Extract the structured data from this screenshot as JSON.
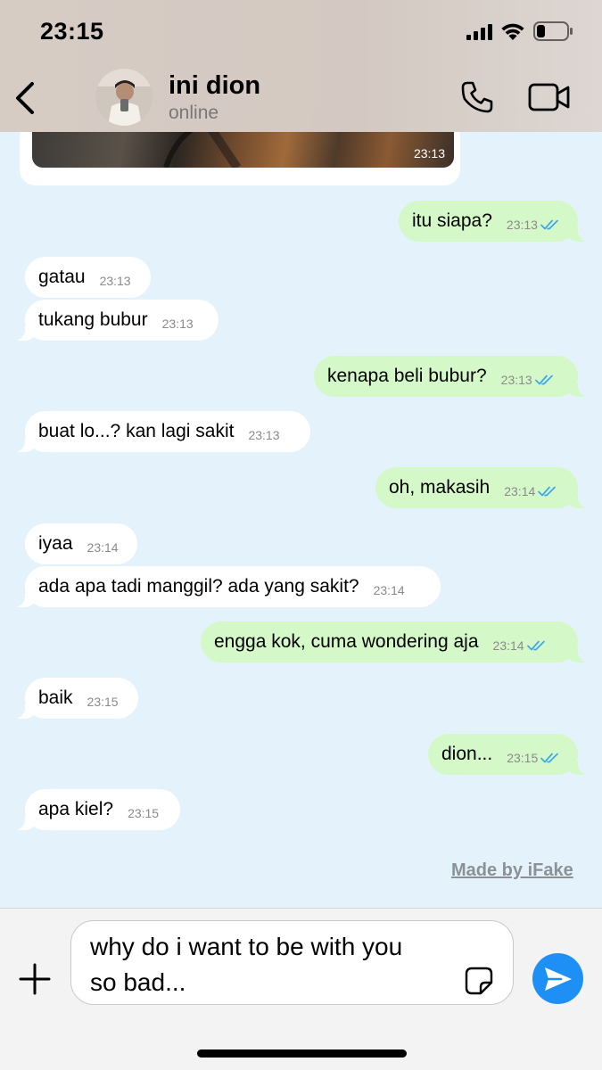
{
  "status_bar": {
    "time": "23:15"
  },
  "header": {
    "contact_name": "ini dion",
    "contact_status": "online"
  },
  "image_message": {
    "time": "23:13"
  },
  "messages": [
    {
      "direction": "out",
      "text": "itu siapa?",
      "time": "23:13",
      "read": true
    },
    {
      "direction": "in",
      "text": "gatau",
      "time": "23:13"
    },
    {
      "direction": "in",
      "text": "tukang bubur",
      "time": "23:13"
    },
    {
      "direction": "out",
      "text": "kenapa beli bubur?",
      "time": "23:13",
      "read": true
    },
    {
      "direction": "in",
      "text": "buat lo...? kan lagi sakit",
      "time": "23:13"
    },
    {
      "direction": "out",
      "text": "oh, makasih",
      "time": "23:14",
      "read": true
    },
    {
      "direction": "in",
      "text": "iyaa",
      "time": "23:14"
    },
    {
      "direction": "in",
      "text": "ada apa tadi manggil? ada yang sakit?",
      "time": "23:14"
    },
    {
      "direction": "out",
      "text": "engga kok, cuma wondering aja",
      "time": "23:14",
      "read": true
    },
    {
      "direction": "in",
      "text": "baik",
      "time": "23:15"
    },
    {
      "direction": "out",
      "text": "dion...",
      "time": "23:15",
      "read": true
    },
    {
      "direction": "in",
      "text": "apa kiel?",
      "time": "23:15"
    }
  ],
  "watermark": "Made by iFake",
  "composer": {
    "draft_line1": "why do i want to be with you",
    "draft_line2": "so bad..."
  },
  "colors": {
    "chat_background": "#e4f3fb",
    "outgoing_bubble": "#d4f8c8",
    "incoming_bubble": "#ffffff",
    "read_checks": "#3ea6ec",
    "send_button": "#1e8ff5"
  },
  "icons": [
    "back-icon",
    "call-icon",
    "video-icon",
    "plus-icon",
    "sticker-icon",
    "send-icon",
    "signal-icon",
    "wifi-icon",
    "battery-icon"
  ]
}
